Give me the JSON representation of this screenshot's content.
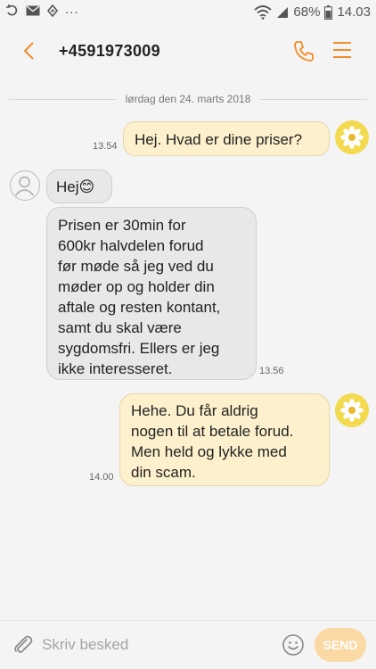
{
  "status_bar": {
    "battery_percent": "68%",
    "clock": "14.03",
    "more": "..."
  },
  "header": {
    "contact": "+4591973009"
  },
  "conversation": {
    "date_separator": "lørdag den 24. marts 2018",
    "messages": [
      {
        "direction": "outgoing",
        "text": "Hej. Hvad er dine priser?",
        "time": "13.54"
      },
      {
        "direction": "incoming",
        "text": "Hej😊",
        "time": ""
      },
      {
        "direction": "incoming",
        "lines": [
          "Prisen er 30min for",
          "600kr halvdelen forud",
          "før møde så jeg ved du",
          "møder op og holder din",
          "aftale og resten kontant,",
          "samt du skal være",
          "sygdomsfri. Ellers er jeg",
          "ikke interesseret."
        ],
        "time": "13.56"
      },
      {
        "direction": "outgoing",
        "lines": [
          "Hehe. Du får aldrig",
          "nogen til at betale forud.",
          "Men held og lykke med",
          "din scam."
        ],
        "time": "14.00"
      }
    ]
  },
  "composer": {
    "placeholder": "Skriv besked",
    "send_label": "SEND"
  },
  "colors": {
    "accent": "#f28c28",
    "outgoing_bubble": "#fdf0cc",
    "incoming_bubble": "#e8e8e8",
    "send_button": "#fbd9a4"
  },
  "icons": [
    "refresh-status-icon",
    "mail-status-icon",
    "usb-status-icon",
    "wifi-icon",
    "signal-icon",
    "battery-icon",
    "back-arrow-icon",
    "phone-icon",
    "menu-icon",
    "flower-avatar-icon",
    "person-avatar-icon",
    "paperclip-icon",
    "smiley-icon"
  ]
}
